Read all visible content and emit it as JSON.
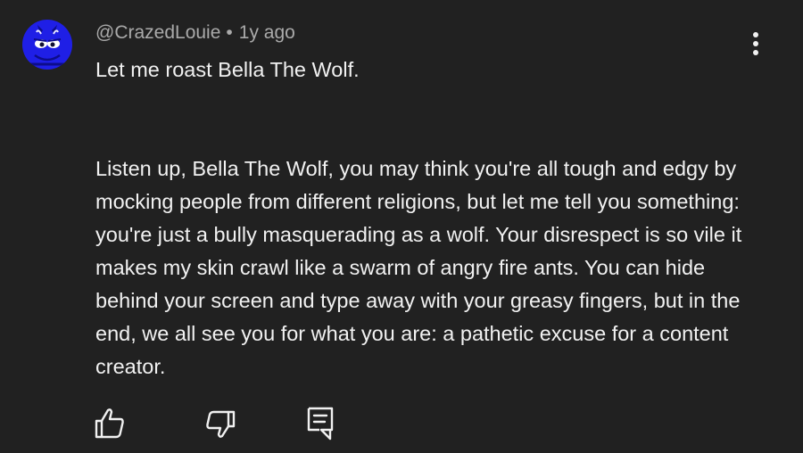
{
  "comment": {
    "author": "@CrazedLouie",
    "separator": "•",
    "timestamp": "1y ago",
    "first_line": "Let me roast Bella The Wolf.",
    "body": "Listen up, Bella The Wolf, you may think you're all tough and edgy by mocking people from different religions, but let me tell you something: you're just a bully masquerading as a wolf. Your disrespect is so vile it makes my skin crawl like a swarm of angry fire ants. You can hide behind your screen and type away with your greasy fingers, but in the end, we all see you for what you are: a pathetic excuse for a content creator."
  },
  "icons": {
    "avatar": "blue-devil-avatar",
    "menu": "more-vert-icon",
    "like": "thumb-up-icon",
    "dislike": "thumb-down-icon",
    "reply": "reply-comment-icon"
  },
  "colors": {
    "background": "#212121",
    "text_primary": "#f1f1f1",
    "text_secondary": "#aaaaaa",
    "avatar_blue": "#1f1fe6"
  }
}
